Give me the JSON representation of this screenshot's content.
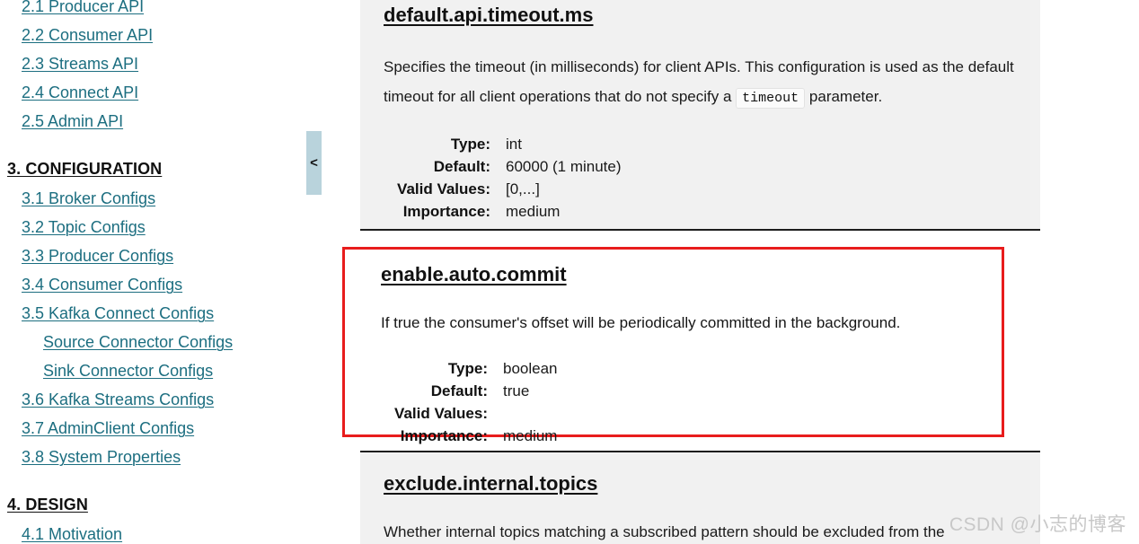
{
  "sidebar": {
    "items": [
      {
        "label": "2.1 Producer API",
        "type": "link",
        "level": 1,
        "clipped": true
      },
      {
        "label": "2.2 Consumer API",
        "type": "link",
        "level": 1
      },
      {
        "label": "2.3 Streams API",
        "type": "link",
        "level": 1
      },
      {
        "label": "2.4 Connect API",
        "type": "link",
        "level": 1
      },
      {
        "label": "2.5 Admin API",
        "type": "link",
        "level": 1
      },
      {
        "label": "3. CONFIGURATION",
        "type": "section",
        "level": 0
      },
      {
        "label": "3.1 Broker Configs",
        "type": "link",
        "level": 1
      },
      {
        "label": "3.2 Topic Configs",
        "type": "link",
        "level": 1
      },
      {
        "label": "3.3 Producer Configs",
        "type": "link",
        "level": 1
      },
      {
        "label": "3.4 Consumer Configs",
        "type": "link",
        "level": 1
      },
      {
        "label": "3.5 Kafka Connect Configs",
        "type": "link",
        "level": 1
      },
      {
        "label": "Source Connector Configs",
        "type": "link",
        "level": 2
      },
      {
        "label": "Sink Connector Configs",
        "type": "link",
        "level": 2
      },
      {
        "label": "3.6 Kafka Streams Configs",
        "type": "link",
        "level": 1
      },
      {
        "label": "3.7 AdminClient Configs",
        "type": "link",
        "level": 1
      },
      {
        "label": "3.8 System Properties",
        "type": "link",
        "level": 1
      },
      {
        "label": "4. DESIGN",
        "type": "section",
        "level": 0
      },
      {
        "label": "4.1 Motivation",
        "type": "link",
        "level": 1
      }
    ],
    "link_color": "#1c6e80"
  },
  "collapse_toggle": {
    "label": "<",
    "icon": "chevron-left-icon",
    "color": "#b9d3dc"
  },
  "content": {
    "blocks": [
      {
        "name": "default.api.timeout.ms",
        "description_before": "Specifies the timeout (in milliseconds) for client APIs. This configuration is used as the default timeout for all client operations that do not specify a ",
        "description_code": "timeout",
        "description_after": " parameter.",
        "meta": [
          {
            "key": "Type:",
            "value": "int"
          },
          {
            "key": "Default:",
            "value": "60000 (1 minute)"
          },
          {
            "key": "Valid Values:",
            "value": "[0,...]"
          },
          {
            "key": "Importance:",
            "value": "medium"
          }
        ]
      },
      {
        "name": "enable.auto.commit",
        "description": "If true the consumer's offset will be periodically committed in the background.",
        "highlighted": true,
        "highlight_color": "#e81c1c",
        "meta": [
          {
            "key": "Type:",
            "value": "boolean"
          },
          {
            "key": "Default:",
            "value": "true"
          },
          {
            "key": "Valid Values:",
            "value": ""
          },
          {
            "key": "Importance:",
            "value": "medium"
          }
        ]
      },
      {
        "name": "exclude.internal.topics",
        "description": "Whether internal topics matching a subscribed pattern should be excluded from the"
      }
    ]
  },
  "watermark": {
    "text": "CSDN @小志的博客"
  }
}
